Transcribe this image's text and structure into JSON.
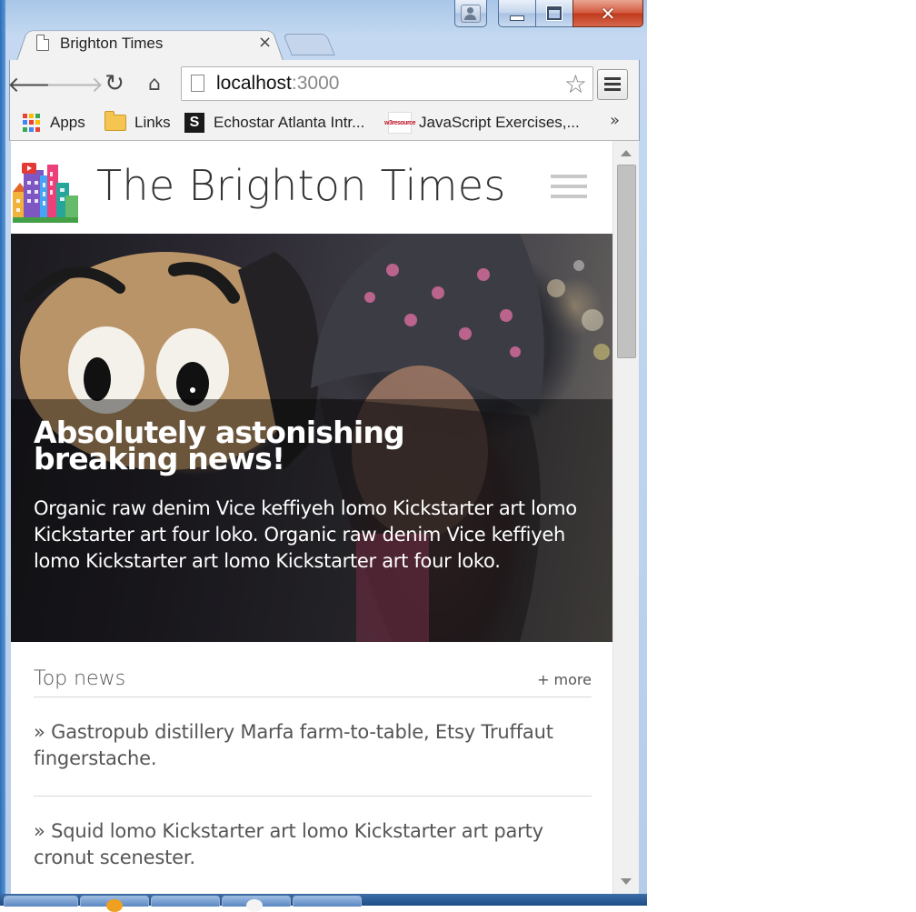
{
  "browser": {
    "tab_title": "Brighton Times",
    "tab_close": "×",
    "url_host": "localhost",
    "url_port": ":3000",
    "bookmarks": {
      "apps": "Apps",
      "links": "Links",
      "echostar": "Echostar Atlanta Intr...",
      "echostar_icon_letter": "S",
      "javascript": "JavaScript Exercises,...",
      "javascript_icon_text": "w3resource",
      "more": "»"
    }
  },
  "site": {
    "title": "The Brighton Times",
    "hero": {
      "headline": "Absolutely astonishing breaking news!",
      "body": "Organic raw denim Vice keffiyeh lomo Kickstarter art lomo Kickstarter art four loko. Organic raw denim Vice keffiyeh lomo Kickstarter art lomo Kickstarter art four loko."
    },
    "top_news": {
      "title": "Top news",
      "more": "+ more",
      "items": [
        "» Gastropub distillery Marfa farm-to-table, Etsy Truffaut fingerstache.",
        "» Squid lomo Kickstarter art lomo Kickstarter art party cronut scenester."
      ]
    }
  },
  "colors": {
    "window_frame": "#b6cdea",
    "close_button": "#c1391c",
    "text_dark": "#333333",
    "text_muted": "#555555"
  },
  "icons": [
    "user-icon",
    "minimize-icon",
    "maximize-icon",
    "close-icon",
    "page-icon",
    "back-arrow-icon",
    "forward-arrow-icon",
    "reload-icon",
    "home-icon",
    "star-icon",
    "chrome-menu-icon",
    "apps-grid-icon",
    "folder-icon",
    "echostar-favicon",
    "w3resource-favicon",
    "city-logo-icon",
    "hamburger-menu-icon"
  ]
}
